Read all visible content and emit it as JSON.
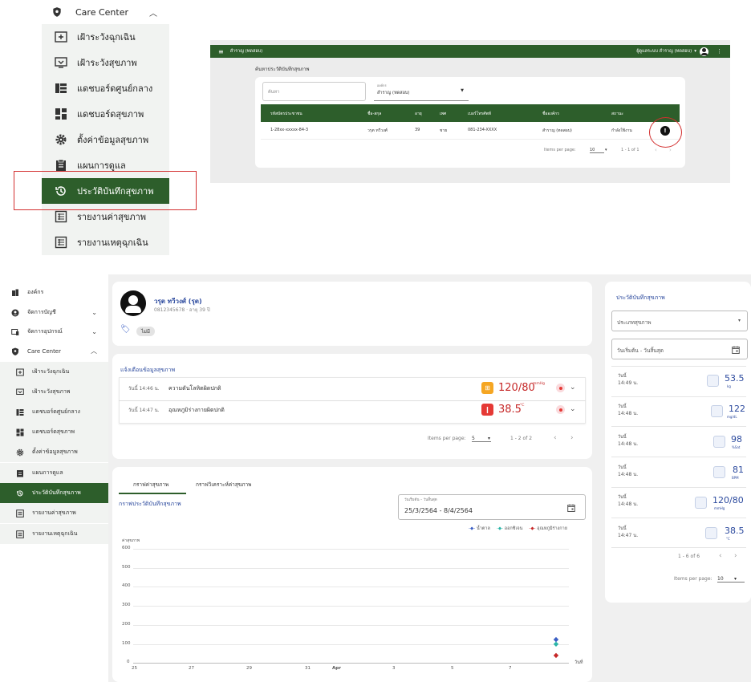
{
  "zoom_menu": {
    "header": "Care Center",
    "items": [
      {
        "label": "เฝ้าระวังฉุกเฉิน",
        "icon": "plus-box-icon"
      },
      {
        "label": "เฝ้าระวังสุขภาพ",
        "icon": "monitor-icon"
      },
      {
        "label": "แดชบอร์ดศูนย์กลาง",
        "icon": "dashboard-list-icon"
      },
      {
        "label": "แดชบอร์ดสุขภาพ",
        "icon": "dashboard-grid-icon"
      },
      {
        "label": "ตั้งค่าข้อมูลสุขภาพ",
        "icon": "gear-icon"
      },
      {
        "label": "แผนการดูแล",
        "icon": "clipboard-icon"
      },
      {
        "label": "ประวัติบันทึกสุขภาพ",
        "icon": "history-icon"
      },
      {
        "label": "รายงานค่าสุขภาพ",
        "icon": "report-icon"
      },
      {
        "label": "รายงานเหตุฉุกเฉิน",
        "icon": "report-icon"
      }
    ]
  },
  "preview": {
    "org": "สำราญ (ทดสอบ)",
    "user": "ผู้ดูแลระบบ สำราญ (ทดสอบ)",
    "title": "ค้นหาประวัติบันทึกสุขภาพ",
    "search_placeholder": "ค้นหา",
    "select_label": "องค์กร",
    "select_value": "สำราญ (ทดสอบ)",
    "columns": [
      "รหัสบัตรประชาชน",
      "ชื่อ-สกุล",
      "อายุ",
      "เพศ",
      "เบอร์โทรศัพท์",
      "ชื่อองค์กร",
      "สถานะ"
    ],
    "row": [
      "1-28xx-xxxxx-84-3",
      "วรุต ทวีวงศ์",
      "39",
      "ชาย",
      "081-234-XXXX",
      "สำราญ (ทดสอบ)",
      "กำลังใช้งาน"
    ],
    "pager": {
      "label": "Items per page:",
      "size": "10",
      "range": "1 - 1 of 1"
    }
  },
  "sidebar": {
    "items": [
      {
        "label": "องค์กร",
        "icon": "building-icon"
      },
      {
        "label": "จัดการบัญชี",
        "icon": "account-icon"
      },
      {
        "label": "จัดการอุปกรณ์",
        "icon": "device-icon"
      },
      {
        "label": "Care Center",
        "icon": "shield-icon"
      },
      {
        "label": "เฝ้าระวังฉุกเฉิน",
        "icon": "plus-box-icon"
      },
      {
        "label": "เฝ้าระวังสุขภาพ",
        "icon": "monitor-icon"
      },
      {
        "label": "แดชบอร์ดศูนย์กลาง",
        "icon": "dashboard-list-icon"
      },
      {
        "label": "แดชบอร์ดสุขภาพ",
        "icon": "dashboard-grid-icon"
      },
      {
        "label": "ตั้งค่าข้อมูลสุขภาพ",
        "icon": "gear-icon"
      },
      {
        "label": "แผนการดูแล",
        "icon": "clipboard-icon"
      },
      {
        "label": "ประวัติบันทึกสุขภาพ",
        "icon": "history-icon"
      },
      {
        "label": "รายงานค่าสุขภาพ",
        "icon": "report-icon"
      },
      {
        "label": "รายงานเหตุฉุกเฉิน",
        "icon": "report-icon"
      }
    ]
  },
  "profile": {
    "name": "วรุต ทวีวงศ์ (รุต)",
    "phone_age": "0812345678 · อายุ 39 ปี",
    "tag": "ไม่มี"
  },
  "alerts": {
    "title": "แจ้งเตือนข้อมูลสุขภาพ",
    "rows": [
      {
        "time": "วันนี้ 14:46 น.",
        "text": "ความดันโลหิตผิดปกติ",
        "value": "120/80",
        "unit": "mmHg",
        "color": "#f5a623"
      },
      {
        "time": "วันนี้ 14:47 น.",
        "text": "อุณหภูมิร่างกายผิดปกติ",
        "value": "38.5",
        "unit": "°C",
        "color": "#e53935"
      }
    ],
    "pager": {
      "label": "Items per page:",
      "size": "5",
      "range": "1 - 2 of 2"
    }
  },
  "graph": {
    "tabs": [
      "กราฟค่าสุขภาพ",
      "กราฟวิเคราะห์ค่าสุขภาพ"
    ],
    "title": "กราฟประวัติบันทึกสุขภาพ",
    "date_label": "วันเริ่มต้น – วันสิ้นสุด",
    "date_value": "25/3/2564 - 8/4/2564",
    "legend": [
      "น้ำตาล",
      "ออกซิเจน",
      "อุณหภูมิร่างกาย"
    ],
    "legend_colors": [
      "#3b5fc4",
      "#2bb5a8",
      "#c62828"
    ]
  },
  "chart_data": {
    "type": "line",
    "ylabel": "ค่าสุขภาพ",
    "xlabel": "วันที่",
    "ylim": [
      0,
      600
    ],
    "yticks": [
      "0",
      "100",
      "200",
      "300",
      "400",
      "500",
      "600"
    ],
    "xticks": [
      "25",
      "27",
      "29",
      "31",
      "Apr",
      "3",
      "5",
      "7"
    ],
    "series": [
      {
        "name": "น้ำตาล",
        "points": [
          {
            "x": "8/4/2564",
            "y": 122
          }
        ]
      },
      {
        "name": "ออกซิเจน",
        "points": [
          {
            "x": "8/4/2564",
            "y": 98
          }
        ]
      },
      {
        "name": "อุณหภูมิร่างกาย",
        "points": [
          {
            "x": "8/4/2564",
            "y": 38.5
          }
        ]
      }
    ]
  },
  "history": {
    "title": "ประวัติบันทึกสุขภาพ",
    "type_placeholder": "ประเภทสุขภาพ",
    "date_placeholder": "วันเริ่มต้น - วันสิ้นสุด",
    "rows": [
      {
        "day": "วันนี้",
        "time": "14:49 น.",
        "value": "53.5",
        "unit": "kg",
        "icon": "scale-icon"
      },
      {
        "day": "วันนี้",
        "time": "14:48 น.",
        "value": "122",
        "unit": "mg/dL",
        "icon": "glucose-icon"
      },
      {
        "day": "วันนี้",
        "time": "14:48 น.",
        "value": "98",
        "unit": "%Sat",
        "icon": "oxygen-icon"
      },
      {
        "day": "วันนี้",
        "time": "14:48 น.",
        "value": "81",
        "unit": "BPM",
        "icon": "heart-rate-icon"
      },
      {
        "day": "วันนี้",
        "time": "14:48 น.",
        "value": "120/80",
        "unit": "mmHg",
        "icon": "blood-pressure-icon"
      },
      {
        "day": "วันนี้",
        "time": "14:47 น.",
        "value": "38.5",
        "unit": "°C",
        "icon": "thermometer-icon"
      }
    ],
    "range": "1 - 6 of 6",
    "pager_label": "Items per page:",
    "pager_size": "10"
  }
}
